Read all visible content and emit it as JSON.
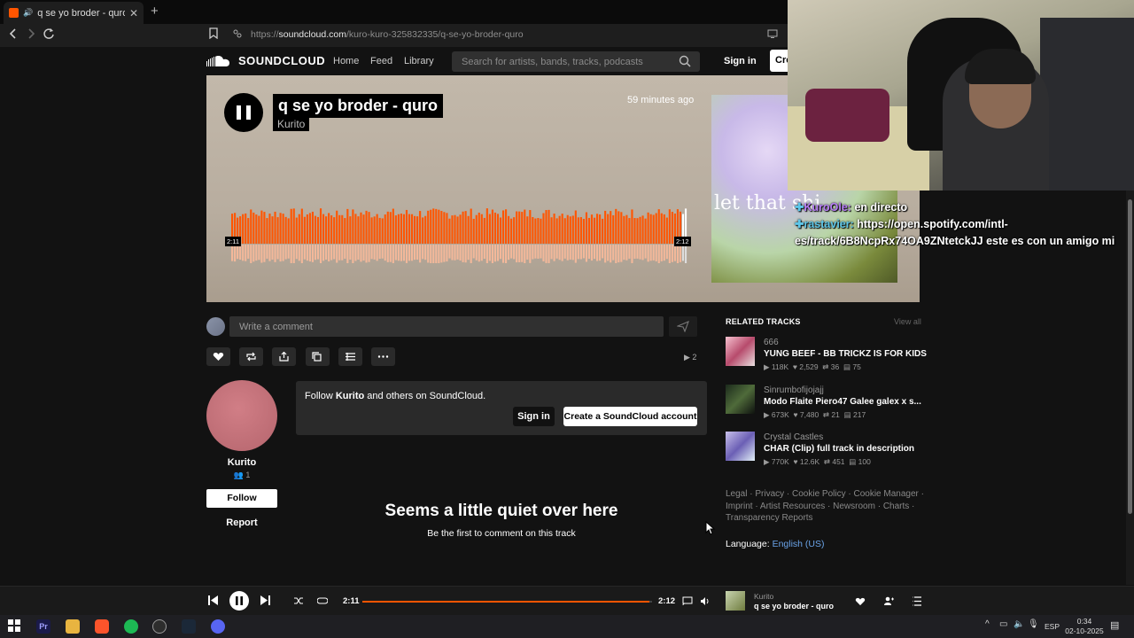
{
  "browser": {
    "tab_title": "q se yo broder - quro by Kurito",
    "url_prefix": "https://",
    "url_host": "soundcloud.com",
    "url_path": "/kuro-kuro-325832335/q-se-yo-broder-quro"
  },
  "header": {
    "logo_text": "SOUNDCLOUD",
    "nav": [
      "Home",
      "Feed",
      "Library"
    ],
    "search_placeholder": "Search for artists, bands, tracks, podcasts",
    "signin": "Sign in",
    "create": "Cre"
  },
  "hero": {
    "title": "q se yo broder - quro",
    "artist": "Kurito",
    "posted": "59 minutes ago",
    "time_current": "2:11",
    "time_total": "2:12",
    "artwork_text": "let that shi",
    "progress_fraction": 0.99
  },
  "stream_overlay": {
    "chat": [
      {
        "user": "KuroOle:",
        "message": " en directo"
      },
      {
        "user": "rastavier:",
        "message": " https://open.spotify.com/intl-es/track/6B8NcpRx74OA9ZNtetckJJ este es con un amigo mi"
      }
    ]
  },
  "comment": {
    "placeholder": "Write a comment"
  },
  "actions": {
    "play_count": "2",
    "icons": [
      "heart-icon",
      "repost-icon",
      "share-icon",
      "copy-link-icon",
      "add-to-playlist-icon",
      "more-icon"
    ]
  },
  "artist": {
    "name": "Kurito",
    "followers": "1",
    "follow_label": "Follow",
    "report_label": "Report"
  },
  "follow_card": {
    "prefix": "Follow ",
    "artist": "Kurito",
    "suffix": " and others on SoundCloud.",
    "signin": "Sign in",
    "create": "Create a SoundCloud account"
  },
  "empty_comments": {
    "title": "Seems a little quiet over here",
    "subtitle": "Be the first to comment on this track"
  },
  "related": {
    "heading": "RELATED TRACKS",
    "view_all": "View all",
    "tracks": [
      {
        "user": "666",
        "title": "YUNG BEEF - BB TRICKZ IS FOR KIDS",
        "plays": "118K",
        "likes": "2,529",
        "reposts": "36",
        "comments": "75"
      },
      {
        "user": "Sinrumbofijojajj",
        "title": "Modo Flaite Piero47 Galee galex x s...",
        "plays": "673K",
        "likes": "7,480",
        "reposts": "21",
        "comments": "217"
      },
      {
        "user": "Crystal Castles",
        "title": "CHAR (Clip) full track in description",
        "plays": "770K",
        "likes": "12.6K",
        "reposts": "451",
        "comments": "100"
      }
    ]
  },
  "footer": {
    "links_line1": "Legal · Privacy · Cookie Policy · Cookie Manager ·",
    "links_line2": "Imprint · Artist Resources · Newsroom · Charts ·",
    "links_line3": "Transparency Reports",
    "language_label": "Language:",
    "language_value": "English (US)"
  },
  "player": {
    "time_current": "2:11",
    "time_total": "2:12",
    "artist": "Kurito",
    "title": "q se yo broder - quro",
    "progress_fraction": 0.99
  },
  "taskbar": {
    "language": "ESP",
    "time": "0:34",
    "date": "02-10-2025"
  },
  "colors": {
    "accent": "#ff5500",
    "link": "#6aa3e8"
  }
}
